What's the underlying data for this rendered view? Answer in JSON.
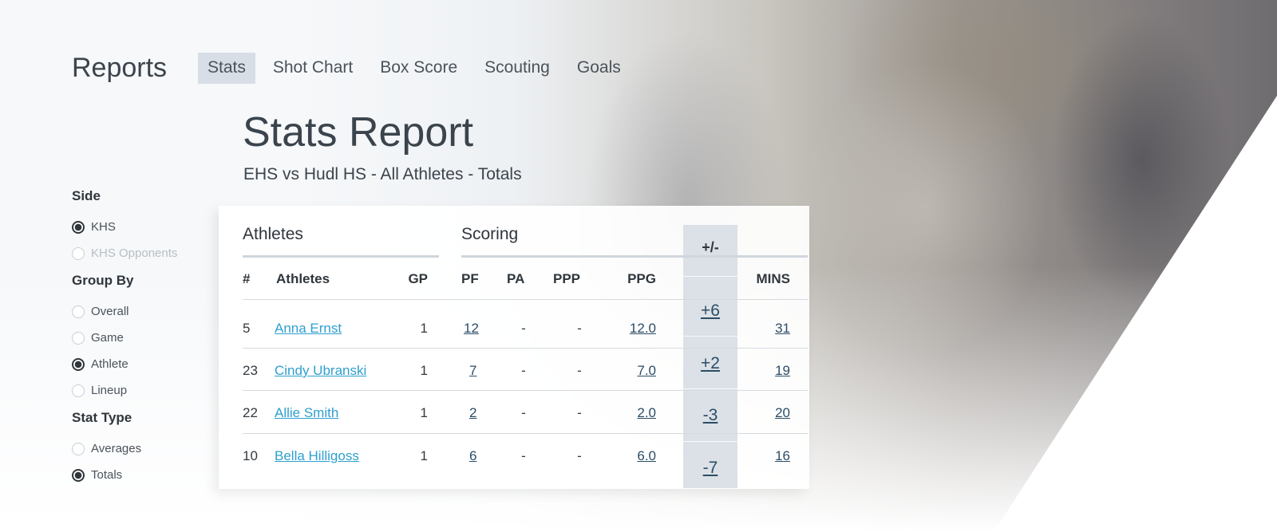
{
  "nav": {
    "brand": "Reports",
    "tabs": [
      {
        "label": "Stats",
        "active": true
      },
      {
        "label": "Shot Chart"
      },
      {
        "label": "Box Score"
      },
      {
        "label": "Scouting"
      },
      {
        "label": "Goals"
      }
    ]
  },
  "header": {
    "title": "Stats Report",
    "subtitle": "EHS vs Hudl HS - All Athletes - Totals"
  },
  "filters": {
    "side": {
      "label": "Side",
      "options": [
        {
          "label": "KHS",
          "checked": true
        },
        {
          "label": "KHS Opponents",
          "checked": false
        }
      ]
    },
    "group_by": {
      "label": "Group By",
      "options": [
        {
          "label": "Overall",
          "checked": false
        },
        {
          "label": "Game",
          "checked": false
        },
        {
          "label": "Athlete",
          "checked": true
        },
        {
          "label": "Lineup",
          "checked": false
        }
      ]
    },
    "stat_type": {
      "label": "Stat Type",
      "options": [
        {
          "label": "Averages",
          "checked": false
        },
        {
          "label": "Totals",
          "checked": true
        }
      ]
    }
  },
  "table": {
    "sections": {
      "athletes": "Athletes",
      "scoring": "Scoring",
      "plus_minus": "+/-"
    },
    "columns": {
      "num": "#",
      "athlete": "Athletes",
      "gp": "GP",
      "pf": "PF",
      "pa": "PA",
      "ppp": "PPP",
      "ppg": "PPG",
      "mins": "MINS"
    },
    "rows": [
      {
        "num": "5",
        "athlete": "Anna Ernst",
        "gp": "1",
        "pf": "12",
        "pa": "-",
        "ppp": "-",
        "ppg": "12.0",
        "pm": "+6",
        "mins": "31"
      },
      {
        "num": "23",
        "athlete": "Cindy Ubranski",
        "gp": "1",
        "pf": "7",
        "pa": "-",
        "ppp": "-",
        "ppg": "7.0",
        "pm": "+2",
        "mins": "19"
      },
      {
        "num": "22",
        "athlete": "Allie Smith",
        "gp": "1",
        "pf": "2",
        "pa": "-",
        "ppp": "-",
        "ppg": "2.0",
        "pm": "-3",
        "mins": "20"
      },
      {
        "num": "10",
        "athlete": "Bella Hilligoss",
        "gp": "1",
        "pf": "6",
        "pa": "-",
        "ppp": "-",
        "ppg": "6.0",
        "pm": "-7",
        "mins": "16"
      }
    ]
  },
  "colors": {
    "accent_link": "#2f9fcf",
    "number_link": "#2b4c66",
    "highlight_col": "#d5dce2"
  }
}
